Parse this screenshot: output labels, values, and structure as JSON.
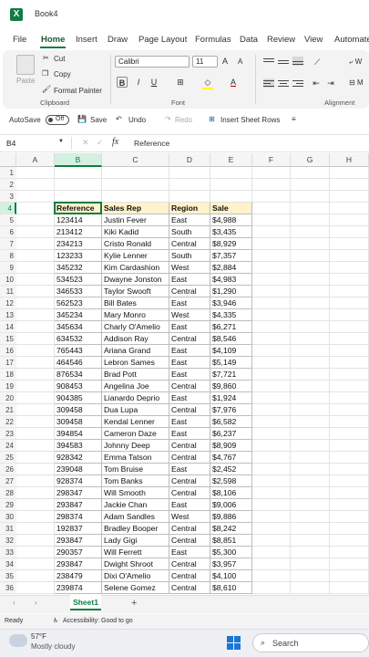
{
  "app": {
    "title": "Book4",
    "icon": "excel-icon",
    "accent": "#107c41"
  },
  "tabs": [
    "File",
    "Home",
    "Insert",
    "Draw",
    "Page Layout",
    "Formulas",
    "Data",
    "Review",
    "View",
    "Automate"
  ],
  "active_tab": "Home",
  "ribbon": {
    "clipboard": {
      "paste": "Paste",
      "cut": "Cut",
      "copy": "Copy",
      "format_painter": "Format Painter",
      "group": "Clipboard"
    },
    "font": {
      "name": "Calibri",
      "size": "11",
      "bold": "B",
      "italic": "I",
      "underline": "U",
      "grow": "A",
      "shrink": "A",
      "group": "Font",
      "font_color": "#c00000",
      "fill_color": "#ffff00"
    },
    "alignment": {
      "group": "Alignment"
    },
    "cut_wrap": "W",
    "cut_merge": "M"
  },
  "qat": {
    "autosave": "AutoSave",
    "toggle": "Off",
    "save": "Save",
    "undo": "Undo",
    "redo": "Redo",
    "insert_rows": "Insert Sheet Rows"
  },
  "formula_bar": {
    "name_box": "B4",
    "fx": "fx",
    "value": "Reference"
  },
  "columns": [
    "A",
    "B",
    "C",
    "D",
    "E",
    "F",
    "G",
    "H"
  ],
  "selected_column": "B",
  "selected_row": 4,
  "rows": [
    "1",
    "2",
    "3",
    "4",
    "5",
    "6",
    "7",
    "8",
    "9",
    "10",
    "11",
    "12",
    "13",
    "14",
    "15",
    "16",
    "17",
    "18",
    "19",
    "20",
    "21",
    "22",
    "23",
    "24",
    "25",
    "26",
    "27",
    "28",
    "29",
    "30",
    "31",
    "32",
    "33",
    "34",
    "35",
    "36"
  ],
  "table": {
    "header": [
      "Reference",
      "Sales Rep",
      "Region",
      "Sale"
    ],
    "records": [
      [
        "123414",
        "Justin Fever",
        "East",
        "$4,988"
      ],
      [
        "213412",
        "Kiki Kadid",
        "South",
        "$3,435"
      ],
      [
        "234213",
        "Cristo Ronald",
        "Central",
        "$8,929"
      ],
      [
        "123233",
        "Kylie Lenner",
        "South",
        "$7,357"
      ],
      [
        "345232",
        "Kim Cardashion",
        "West",
        "$2,884"
      ],
      [
        "534523",
        "Dwayne Jonston",
        "East",
        "$4,983"
      ],
      [
        "346533",
        "Taylor Swooft",
        "Central",
        "$1,290"
      ],
      [
        "562523",
        "Bill Bates",
        "East",
        "$3,946"
      ],
      [
        "345234",
        "Mary Monro",
        "West",
        "$4,335"
      ],
      [
        "345634",
        "Charly O'Amelio",
        "East",
        "$6,271"
      ],
      [
        "634532",
        "Addison Ray",
        "Central",
        "$8,546"
      ],
      [
        "765443",
        "Ariana Grand",
        "East",
        "$4,109"
      ],
      [
        "464546",
        "Lebron Sames",
        "East",
        "$5,149"
      ],
      [
        "876534",
        "Brad Pott",
        "East",
        "$7,721"
      ],
      [
        "908453",
        "Angelina Joe",
        "Central",
        "$9,860"
      ],
      [
        "904385",
        "Lianardo Deprio",
        "East",
        "$1,924"
      ],
      [
        "309458",
        "Dua Lupa",
        "Central",
        "$7,976"
      ],
      [
        "309458",
        "Kendal Lenner",
        "East",
        "$6,582"
      ],
      [
        "394854",
        "Cameron Daze",
        "East",
        "$6,237"
      ],
      [
        "394583",
        "Johnny Deep",
        "Central",
        "$8,909"
      ],
      [
        "928342",
        "Emma Tatson",
        "Central",
        "$4,767"
      ],
      [
        "239048",
        "Tom Bruise",
        "East",
        "$2,452"
      ],
      [
        "928374",
        "Tom Banks",
        "Central",
        "$2,598"
      ],
      [
        "298347",
        "Will Smooth",
        "Central",
        "$8,106"
      ],
      [
        "293847",
        "Jackie Chan",
        "East",
        "$9,006"
      ],
      [
        "298374",
        "Adam Sandles",
        "West",
        "$9,886"
      ],
      [
        "192837",
        "Bradley Booper",
        "Central",
        "$8,242"
      ],
      [
        "293847",
        "Lady Gigi",
        "Central",
        "$8,851"
      ],
      [
        "290357",
        "Will Ferrett",
        "East",
        "$5,300"
      ],
      [
        "293847",
        "Dwight Shroot",
        "Central",
        "$3,957"
      ],
      [
        "238479",
        "Dixi O'Amelio",
        "Central",
        "$4,100"
      ],
      [
        "239874",
        "Selene Gomez",
        "Central",
        "$8,610"
      ]
    ]
  },
  "sheet_tabs": [
    "Sheet1"
  ],
  "add_sheet": "+",
  "status": {
    "ready": "Ready",
    "accessibility": "Accessibility: Good to go"
  },
  "taskbar": {
    "temp": "57°F",
    "weather": "Mostly cloudy",
    "search": "Search"
  }
}
